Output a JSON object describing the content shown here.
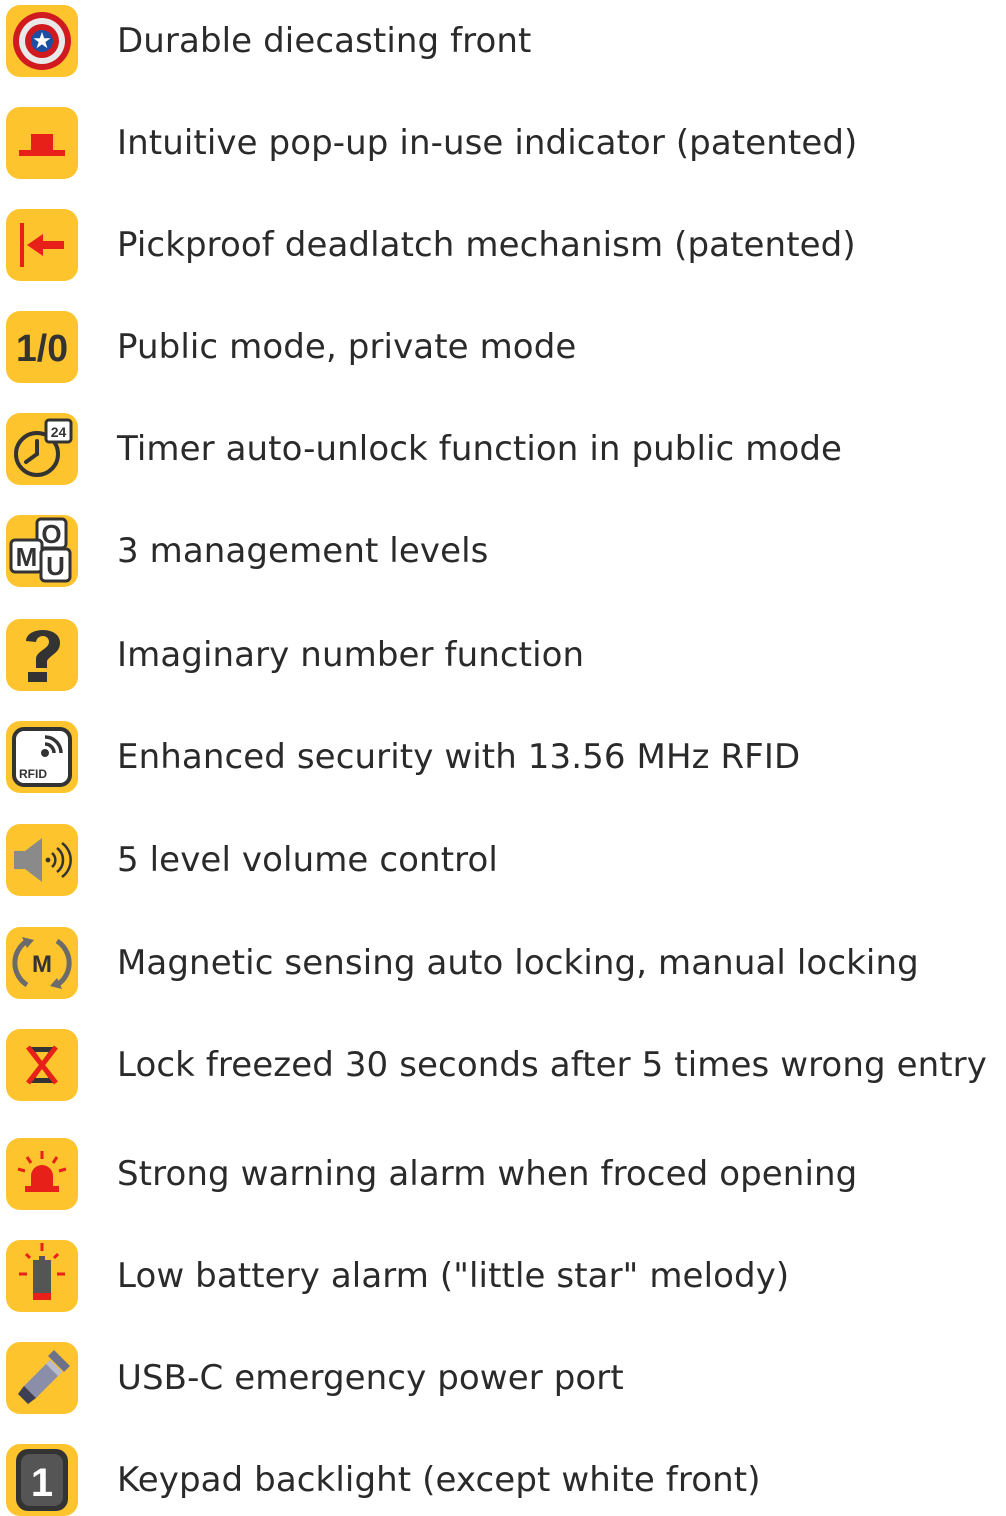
{
  "features": [
    {
      "icon": "shield-icon",
      "label": "Durable diecasting front"
    },
    {
      "icon": "indicator-icon",
      "label": "Intuitive pop-up in-use indicator (patented)"
    },
    {
      "icon": "deadlatch-icon",
      "label": "Pickproof deadlatch mechanism (patented)"
    },
    {
      "icon": "mode-toggle-icon",
      "label": "Public mode, private mode",
      "icon_text": "1/0"
    },
    {
      "icon": "timer-icon",
      "label": "Timer auto-unlock function in public mode",
      "icon_text": "24"
    },
    {
      "icon": "management-levels-icon",
      "label": "3 management levels",
      "icon_text": [
        "O",
        "M",
        "U"
      ]
    },
    {
      "icon": "question-icon",
      "label": "Imaginary number function"
    },
    {
      "icon": "rfid-icon",
      "label": "Enhanced security with 13.56 MHz RFID",
      "icon_text": "RFID"
    },
    {
      "icon": "volume-icon",
      "label": "5 level volume control"
    },
    {
      "icon": "magnetic-lock-icon",
      "label": "Magnetic sensing auto locking, manual locking",
      "icon_text": "M"
    },
    {
      "icon": "freeze-icon",
      "label": "Lock freezed 30 seconds after 5 times wrong entry"
    },
    {
      "icon": "alarm-siren-icon",
      "label": "Strong warning alarm when froced opening"
    },
    {
      "icon": "low-battery-icon",
      "label": "Low battery alarm (\"little star\" melody)"
    },
    {
      "icon": "usb-c-icon",
      "label": "USB-C emergency power port"
    },
    {
      "icon": "keypad-backlight-icon",
      "label": "Keypad backlight (except white front)",
      "icon_text": "1"
    }
  ],
  "colors": {
    "icon_background": "#fdc42e",
    "text": "#2a2a2a",
    "accent_red": "#e8201a",
    "icon_dark": "#333333"
  }
}
